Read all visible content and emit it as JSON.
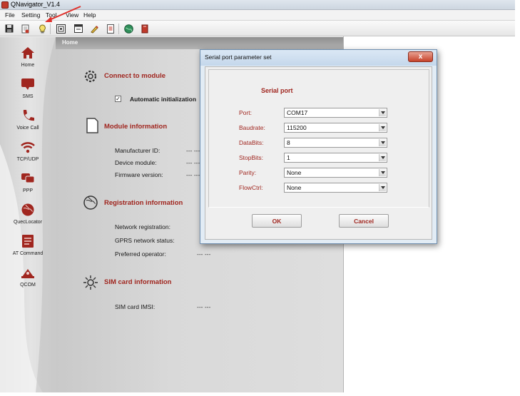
{
  "window": {
    "title": "QNavigator_V1.4"
  },
  "menu": [
    "File",
    "Setting",
    "Tool",
    "View",
    "Help"
  ],
  "toolbar": {
    "icons": [
      "save-icon",
      "open-icon",
      "lightbulb-icon",
      "config-icon",
      "window-icon",
      "edit-icon",
      "document-icon",
      "globe-icon",
      "book-icon"
    ]
  },
  "sidebar": {
    "items": [
      {
        "label": "Home",
        "icon": "home-icon"
      },
      {
        "label": "SMS",
        "icon": "sms-icon"
      },
      {
        "label": "Voice Call",
        "icon": "phone-icon"
      },
      {
        "label": "TCP/UDP",
        "icon": "wifi-icon"
      },
      {
        "label": "PPP",
        "icon": "ppp-icon"
      },
      {
        "label": "QuecLocator",
        "icon": "globe-icon"
      },
      {
        "label": "AT Command",
        "icon": "at-command-icon"
      },
      {
        "label": "QCOM",
        "icon": "qcom-icon"
      }
    ]
  },
  "home": {
    "header": "Home",
    "connect": {
      "title": "Connect to module",
      "auto_init_label": "Automatic initialization",
      "auto_init_checked": true
    },
    "module": {
      "title": "Module information",
      "fields": [
        {
          "label": "Manufacturer ID:",
          "value": "--- ---"
        },
        {
          "label": "Device module:",
          "value": "--- ---"
        },
        {
          "label": "Firmware version:",
          "value": "--- ---"
        }
      ]
    },
    "registration": {
      "title": "Registration information",
      "fields": [
        {
          "label": "Network registration:",
          "value": ""
        },
        {
          "label": "GPRS network status:",
          "value": ""
        },
        {
          "label": "Preferred operator:",
          "value": "--- ---"
        }
      ]
    },
    "sim": {
      "title": "SIM card information",
      "fields": [
        {
          "label": "SIM card IMSI:",
          "value": "--- ---"
        }
      ]
    }
  },
  "dialog": {
    "title": "Serial port parameter set",
    "close_label": "x",
    "group_title": "Serial port",
    "fields": [
      {
        "label": "Port:",
        "value": "COM17"
      },
      {
        "label": "Baudrate:",
        "value": "115200"
      },
      {
        "label": "DataBits:",
        "value": "8"
      },
      {
        "label": "StopBits:",
        "value": "1"
      },
      {
        "label": "Parity:",
        "value": "None"
      },
      {
        "label": "FlowCtrl:",
        "value": "None"
      }
    ],
    "ok_label": "OK",
    "cancel_label": "Cancel"
  },
  "colors": {
    "accent_red": "#a0261f",
    "dialog_frame": "#e2ecf5",
    "annotation_arrow": "#e0302a"
  }
}
